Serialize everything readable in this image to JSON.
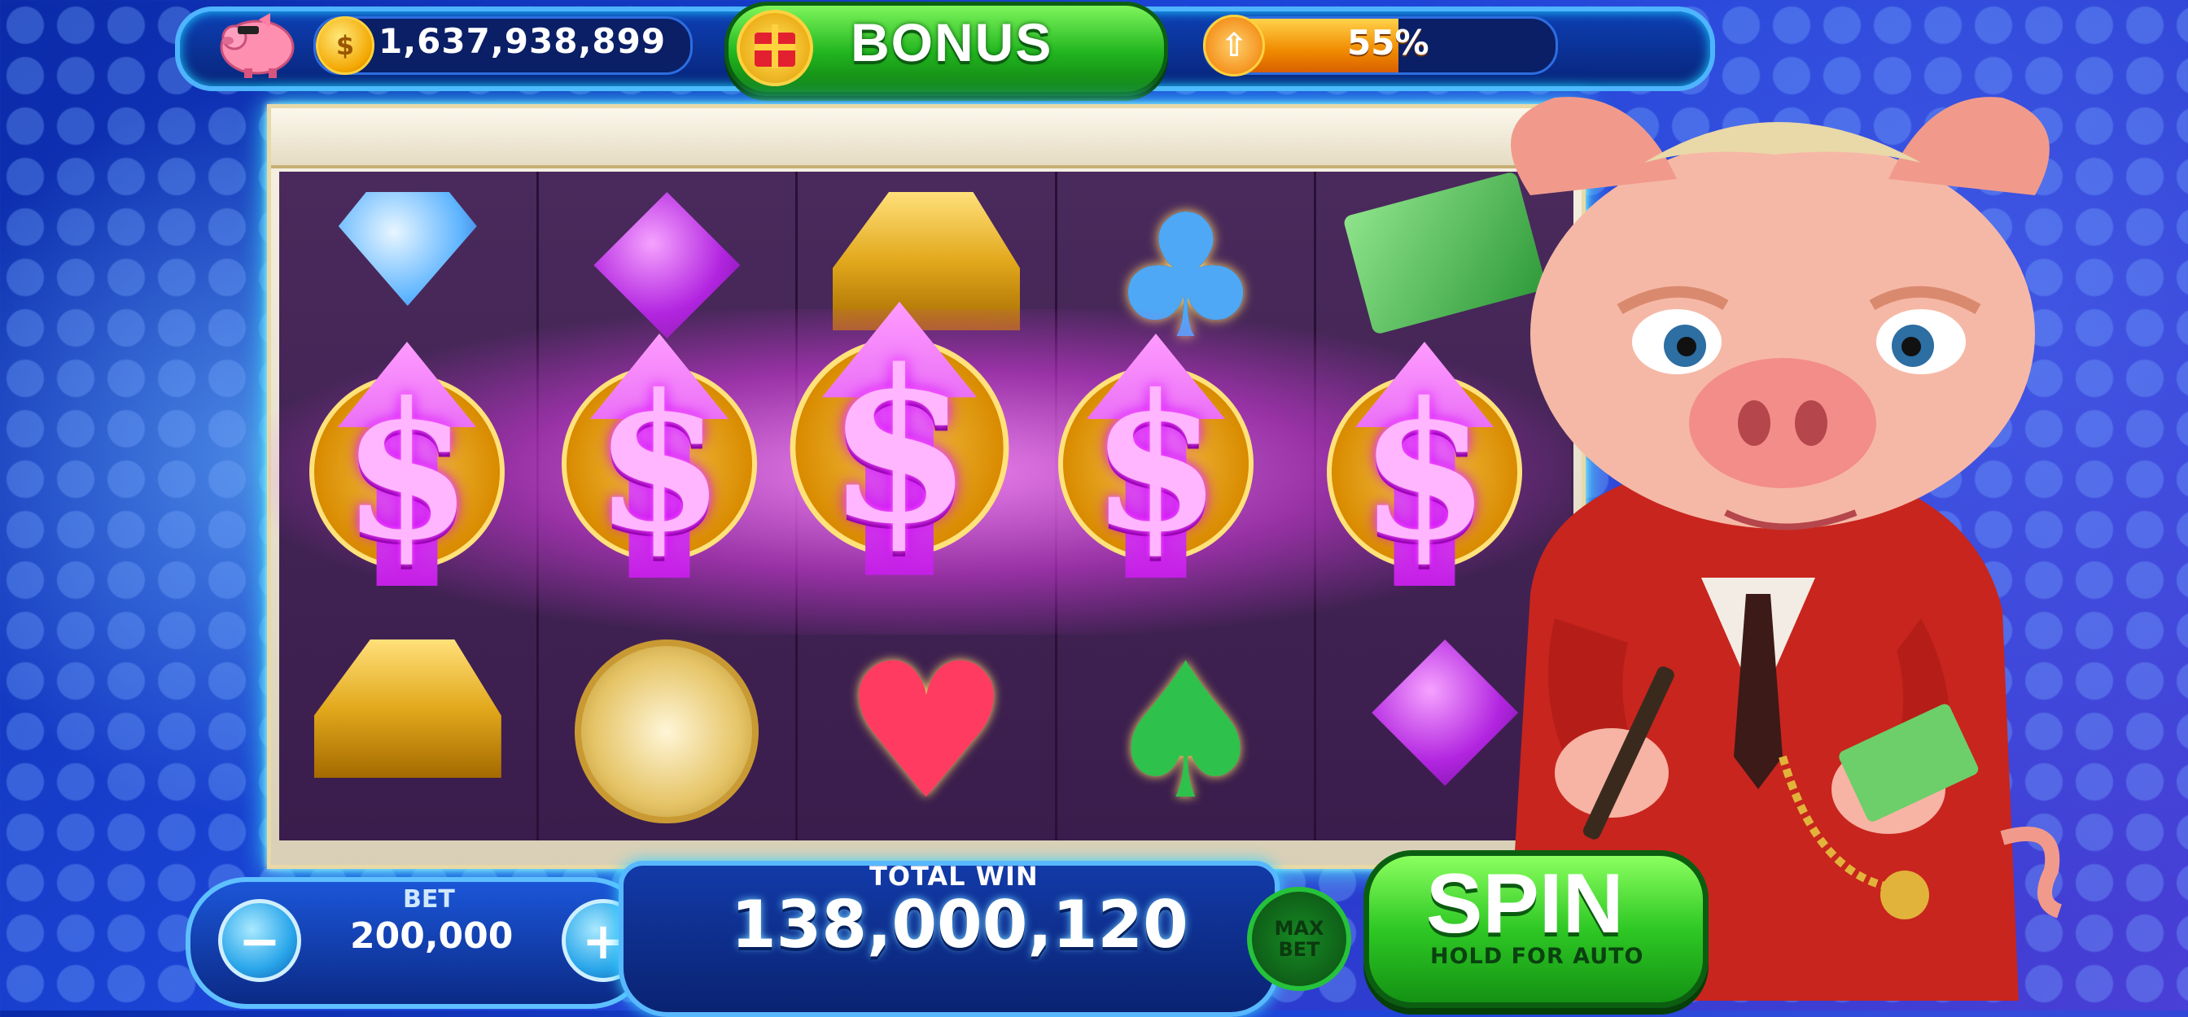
{
  "top_bar": {
    "coins": "1,637,938,899",
    "coin_symbol": "$",
    "bonus_label": "BONUS",
    "level_progress_label": "55%",
    "level_progress": 0.55
  },
  "reels": {
    "top_row": [
      "diamond-icon",
      "purple-gem-icon",
      "gold-bars-icon",
      "club-icon",
      "cash-stack-icon"
    ],
    "middle_row": [
      "dollar-arrow-icon",
      "dollar-arrow-icon",
      "dollar-arrow-icon",
      "dollar-arrow-icon",
      "dollar-arrow-icon"
    ],
    "bottom_row": [
      "gold-bars-icon",
      "pocket-watch-icon",
      "heart-icon",
      "spade-icon",
      "purple-gem-icon"
    ],
    "win_symbol_glyph": "$",
    "club_glyph": "♣",
    "heart_glyph": "♥",
    "spade_glyph": "♠"
  },
  "bottom_bar": {
    "bet_label": "BET",
    "bet_value": "200,000",
    "minus_glyph": "−",
    "plus_glyph": "+",
    "total_win_label": "TOTAL WIN",
    "total_win_value": "138,000,120",
    "max_bet_line1": "MAX",
    "max_bet_line2": "BET",
    "spin_label": "SPIN",
    "spin_sub_label": "HOLD FOR AUTO"
  },
  "colors": {
    "spin_green": "#2ec824",
    "win_glow": "#d400ff",
    "background_blue": "#1c46d9"
  }
}
